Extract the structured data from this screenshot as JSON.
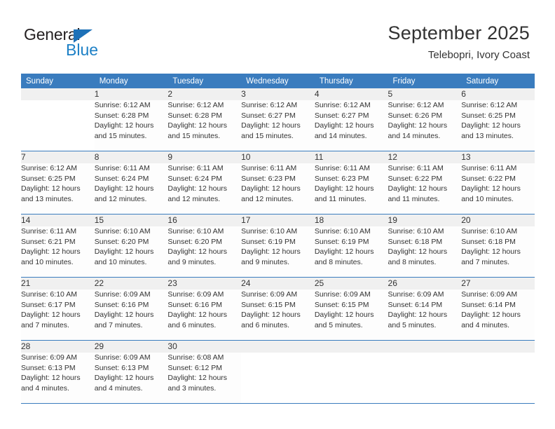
{
  "logo": {
    "word1": "General",
    "word2": "Blue",
    "triangle_color": "#1d71b8",
    "blue_color": "#1d80c6"
  },
  "header": {
    "title": "September 2025",
    "subtitle": "Telebopri, Ivory Coast",
    "accent_color": "#3a7cbe"
  },
  "weekday_headers": [
    "Sunday",
    "Monday",
    "Tuesday",
    "Wednesday",
    "Thursday",
    "Friday",
    "Saturday"
  ],
  "weeks": [
    [
      {
        "day": "",
        "lines": []
      },
      {
        "day": "1",
        "lines": [
          "Sunrise: 6:12 AM",
          "Sunset: 6:28 PM",
          "Daylight: 12 hours",
          "and 15 minutes."
        ]
      },
      {
        "day": "2",
        "lines": [
          "Sunrise: 6:12 AM",
          "Sunset: 6:28 PM",
          "Daylight: 12 hours",
          "and 15 minutes."
        ]
      },
      {
        "day": "3",
        "lines": [
          "Sunrise: 6:12 AM",
          "Sunset: 6:27 PM",
          "Daylight: 12 hours",
          "and 15 minutes."
        ]
      },
      {
        "day": "4",
        "lines": [
          "Sunrise: 6:12 AM",
          "Sunset: 6:27 PM",
          "Daylight: 12 hours",
          "and 14 minutes."
        ]
      },
      {
        "day": "5",
        "lines": [
          "Sunrise: 6:12 AM",
          "Sunset: 6:26 PM",
          "Daylight: 12 hours",
          "and 14 minutes."
        ]
      },
      {
        "day": "6",
        "lines": [
          "Sunrise: 6:12 AM",
          "Sunset: 6:25 PM",
          "Daylight: 12 hours",
          "and 13 minutes."
        ]
      }
    ],
    [
      {
        "day": "7",
        "lines": [
          "Sunrise: 6:12 AM",
          "Sunset: 6:25 PM",
          "Daylight: 12 hours",
          "and 13 minutes."
        ]
      },
      {
        "day": "8",
        "lines": [
          "Sunrise: 6:11 AM",
          "Sunset: 6:24 PM",
          "Daylight: 12 hours",
          "and 12 minutes."
        ]
      },
      {
        "day": "9",
        "lines": [
          "Sunrise: 6:11 AM",
          "Sunset: 6:24 PM",
          "Daylight: 12 hours",
          "and 12 minutes."
        ]
      },
      {
        "day": "10",
        "lines": [
          "Sunrise: 6:11 AM",
          "Sunset: 6:23 PM",
          "Daylight: 12 hours",
          "and 12 minutes."
        ]
      },
      {
        "day": "11",
        "lines": [
          "Sunrise: 6:11 AM",
          "Sunset: 6:23 PM",
          "Daylight: 12 hours",
          "and 11 minutes."
        ]
      },
      {
        "day": "12",
        "lines": [
          "Sunrise: 6:11 AM",
          "Sunset: 6:22 PM",
          "Daylight: 12 hours",
          "and 11 minutes."
        ]
      },
      {
        "day": "13",
        "lines": [
          "Sunrise: 6:11 AM",
          "Sunset: 6:22 PM",
          "Daylight: 12 hours",
          "and 10 minutes."
        ]
      }
    ],
    [
      {
        "day": "14",
        "lines": [
          "Sunrise: 6:11 AM",
          "Sunset: 6:21 PM",
          "Daylight: 12 hours",
          "and 10 minutes."
        ]
      },
      {
        "day": "15",
        "lines": [
          "Sunrise: 6:10 AM",
          "Sunset: 6:20 PM",
          "Daylight: 12 hours",
          "and 10 minutes."
        ]
      },
      {
        "day": "16",
        "lines": [
          "Sunrise: 6:10 AM",
          "Sunset: 6:20 PM",
          "Daylight: 12 hours",
          "and 9 minutes."
        ]
      },
      {
        "day": "17",
        "lines": [
          "Sunrise: 6:10 AM",
          "Sunset: 6:19 PM",
          "Daylight: 12 hours",
          "and 9 minutes."
        ]
      },
      {
        "day": "18",
        "lines": [
          "Sunrise: 6:10 AM",
          "Sunset: 6:19 PM",
          "Daylight: 12 hours",
          "and 8 minutes."
        ]
      },
      {
        "day": "19",
        "lines": [
          "Sunrise: 6:10 AM",
          "Sunset: 6:18 PM",
          "Daylight: 12 hours",
          "and 8 minutes."
        ]
      },
      {
        "day": "20",
        "lines": [
          "Sunrise: 6:10 AM",
          "Sunset: 6:18 PM",
          "Daylight: 12 hours",
          "and 7 minutes."
        ]
      }
    ],
    [
      {
        "day": "21",
        "lines": [
          "Sunrise: 6:10 AM",
          "Sunset: 6:17 PM",
          "Daylight: 12 hours",
          "and 7 minutes."
        ]
      },
      {
        "day": "22",
        "lines": [
          "Sunrise: 6:09 AM",
          "Sunset: 6:16 PM",
          "Daylight: 12 hours",
          "and 7 minutes."
        ]
      },
      {
        "day": "23",
        "lines": [
          "Sunrise: 6:09 AM",
          "Sunset: 6:16 PM",
          "Daylight: 12 hours",
          "and 6 minutes."
        ]
      },
      {
        "day": "24",
        "lines": [
          "Sunrise: 6:09 AM",
          "Sunset: 6:15 PM",
          "Daylight: 12 hours",
          "and 6 minutes."
        ]
      },
      {
        "day": "25",
        "lines": [
          "Sunrise: 6:09 AM",
          "Sunset: 6:15 PM",
          "Daylight: 12 hours",
          "and 5 minutes."
        ]
      },
      {
        "day": "26",
        "lines": [
          "Sunrise: 6:09 AM",
          "Sunset: 6:14 PM",
          "Daylight: 12 hours",
          "and 5 minutes."
        ]
      },
      {
        "day": "27",
        "lines": [
          "Sunrise: 6:09 AM",
          "Sunset: 6:14 PM",
          "Daylight: 12 hours",
          "and 4 minutes."
        ]
      }
    ],
    [
      {
        "day": "28",
        "lines": [
          "Sunrise: 6:09 AM",
          "Sunset: 6:13 PM",
          "Daylight: 12 hours",
          "and 4 minutes."
        ]
      },
      {
        "day": "29",
        "lines": [
          "Sunrise: 6:09 AM",
          "Sunset: 6:13 PM",
          "Daylight: 12 hours",
          "and 4 minutes."
        ]
      },
      {
        "day": "30",
        "lines": [
          "Sunrise: 6:08 AM",
          "Sunset: 6:12 PM",
          "Daylight: 12 hours",
          "and 3 minutes."
        ]
      },
      {
        "day": "",
        "lines": []
      },
      {
        "day": "",
        "lines": []
      },
      {
        "day": "",
        "lines": []
      },
      {
        "day": "",
        "lines": []
      }
    ]
  ]
}
